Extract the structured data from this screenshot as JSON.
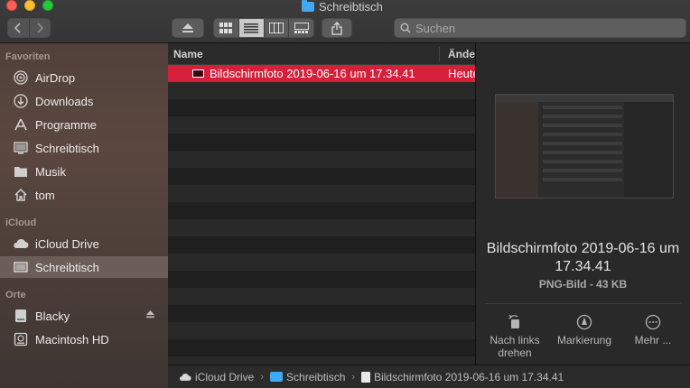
{
  "window": {
    "title": "Schreibtisch"
  },
  "toolbar": {
    "back_icon": "chevron-left-icon",
    "forward_icon": "chevron-right-icon",
    "eject_icon": "eject-icon",
    "view_modes": [
      "icon-view-icon",
      "list-view-icon",
      "column-view-icon",
      "gallery-view-icon"
    ],
    "active_view": "list-view-icon",
    "share_icon": "share-icon"
  },
  "search": {
    "placeholder": "Suchen"
  },
  "sidebar": {
    "sections": [
      {
        "title": "Favoriten"
      },
      {
        "title": "iCloud"
      },
      {
        "title": "Orte"
      }
    ],
    "favorites": [
      {
        "label": "AirDrop",
        "icon": "airdrop-icon"
      },
      {
        "label": "Downloads",
        "icon": "download-icon"
      },
      {
        "label": "Programme",
        "icon": "applications-icon"
      },
      {
        "label": "Schreibtisch",
        "icon": "desktop-icon"
      },
      {
        "label": "Musik",
        "icon": "folder-icon"
      },
      {
        "label": "tom",
        "icon": "home-icon"
      }
    ],
    "icloud": [
      {
        "label": "iCloud Drive",
        "icon": "cloud-icon"
      },
      {
        "label": "Schreibtisch",
        "icon": "folder-icon",
        "selected": true
      }
    ],
    "places": [
      {
        "label": "Blacky",
        "icon": "drive-icon",
        "ejectable": true
      },
      {
        "label": "Macintosh HD",
        "icon": "hard-disk-icon"
      }
    ]
  },
  "list": {
    "columns": {
      "name": "Name",
      "date": "Änder"
    },
    "files": [
      {
        "name": "Bildschirmfoto 2019-06-16 um 17.34.41",
        "date": "Heute",
        "selected": true
      }
    ],
    "accent": "#d6203a"
  },
  "preview": {
    "title": "Bildschirmfoto 2019-06-16 um 17.34.41",
    "subtitle": "PNG-Bild - 43 KB",
    "actions": [
      {
        "label": "Nach links drehen",
        "icon": "rotate-left-icon"
      },
      {
        "label": "Markierung",
        "icon": "markup-icon"
      },
      {
        "label": "Mehr ...",
        "icon": "more-icon"
      }
    ]
  },
  "pathbar": {
    "segments": [
      {
        "label": "iCloud Drive",
        "icon": "cloud-icon"
      },
      {
        "label": "Schreibtisch",
        "icon": "folder-icon"
      },
      {
        "label": "Bildschirmfoto 2019-06-16 um 17.34.41",
        "icon": "image-file-icon"
      }
    ]
  }
}
